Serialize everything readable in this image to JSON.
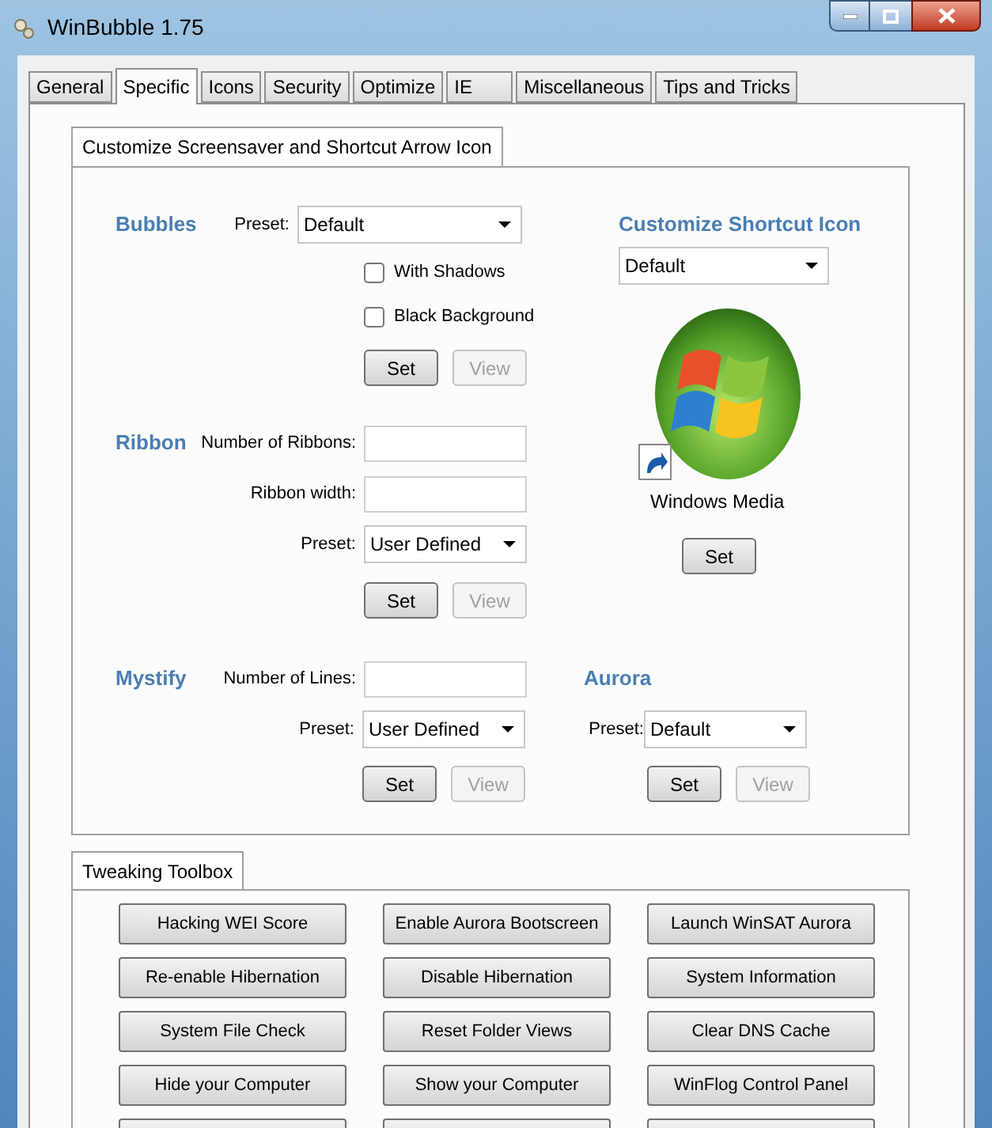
{
  "window": {
    "title": "WinBubble 1.75"
  },
  "tabs": [
    {
      "label": "General",
      "selected": false
    },
    {
      "label": "Specific",
      "selected": true
    },
    {
      "label": "Icons",
      "selected": false
    },
    {
      "label": "Security",
      "selected": false
    },
    {
      "label": "Optimize",
      "selected": false
    },
    {
      "label": "IE",
      "selected": false
    },
    {
      "label": "Miscellaneous",
      "selected": false
    },
    {
      "label": "Tips and Tricks",
      "selected": false
    }
  ],
  "screensaver_group": {
    "title": "Customize Screensaver and Shortcut Arrow Icon",
    "bubbles": {
      "title": "Bubbles",
      "preset_label": "Preset:",
      "preset": "Default",
      "checkboxes": [
        {
          "label": "With Shadows",
          "checked": false
        },
        {
          "label": "Black Background",
          "checked": false
        }
      ],
      "buttons": [
        {
          "label": "Set",
          "disabled": false
        },
        {
          "label": "View",
          "disabled": true
        }
      ]
    },
    "ribbon": {
      "title": "Ribbon",
      "fields": [
        {
          "label": "Number of Ribbons:"
        },
        {
          "label": "Ribbon width:"
        }
      ],
      "preset_label": "Preset:",
      "preset": "User Defined",
      "buttons": [
        {
          "label": "Set",
          "disabled": false
        },
        {
          "label": "View",
          "disabled": true
        }
      ]
    },
    "shortcut_icon": {
      "title": "Customize Shortcut Icon",
      "selection": "Default",
      "icon_caption": "Windows Media",
      "button": {
        "label": "Set",
        "disabled": false
      }
    },
    "mystify": {
      "title": "Mystify",
      "fields": [
        {
          "label": "Number of Lines:"
        }
      ],
      "preset_label": "Preset:",
      "preset": "User Defined",
      "buttons": [
        {
          "label": "Set",
          "disabled": false
        },
        {
          "label": "View",
          "disabled": true
        }
      ]
    },
    "aurora": {
      "title": "Aurora",
      "preset_label": "Preset:",
      "preset": "Default",
      "buttons": [
        {
          "label": "Set",
          "disabled": false
        },
        {
          "label": "View",
          "disabled": true
        }
      ]
    }
  },
  "toolbox": {
    "title": "Tweaking Toolbox",
    "buttons": [
      "Hacking WEI Score",
      "Enable Aurora Bootscreen",
      "Launch WinSAT Aurora",
      "Re-enable Hibernation",
      "Disable Hibernation",
      "System Information",
      "System File Check",
      "Reset Folder Views",
      "Clear DNS Cache",
      "Hide your Computer",
      "Show your Computer",
      "WinFlog Control Panel"
    ]
  }
}
